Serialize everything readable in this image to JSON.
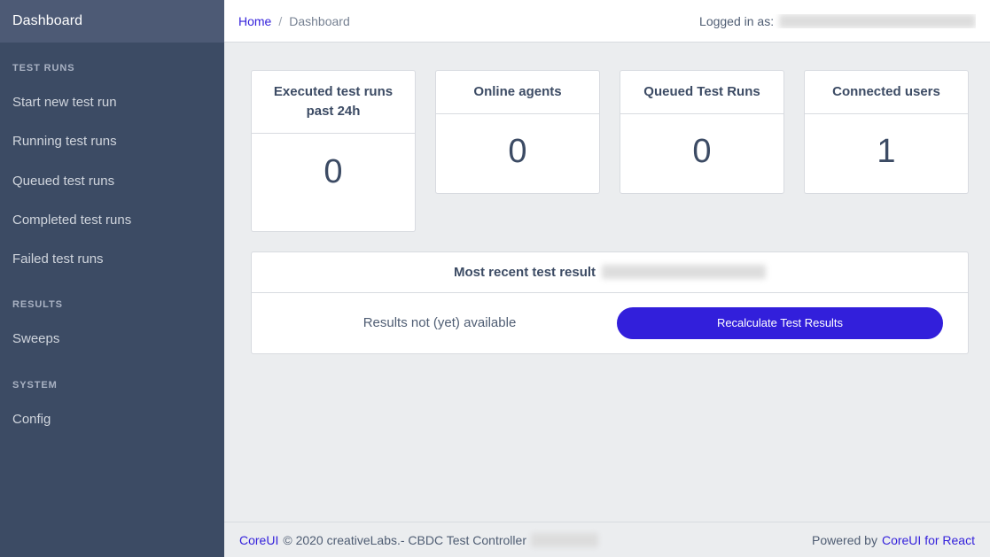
{
  "sidebar": {
    "brand": "Dashboard",
    "groups": [
      {
        "title": "TEST RUNS",
        "items": [
          {
            "label": "Start new test run"
          },
          {
            "label": "Running test runs"
          },
          {
            "label": "Queued test runs"
          },
          {
            "label": "Completed test runs"
          },
          {
            "label": "Failed test runs"
          }
        ]
      },
      {
        "title": "RESULTS",
        "items": [
          {
            "label": "Sweeps"
          }
        ]
      },
      {
        "title": "SYSTEM",
        "items": [
          {
            "label": "Config"
          }
        ]
      }
    ]
  },
  "header": {
    "breadcrumb": {
      "home": "Home",
      "separator": "/",
      "current": "Dashboard"
    },
    "logged_in_label": "Logged in as:",
    "logged_in_user": "Redacted User Name Organization"
  },
  "stats": [
    {
      "title": "Executed test runs past 24h",
      "value": "0",
      "tall": true
    },
    {
      "title": "Online agents",
      "value": "0",
      "tall": false
    },
    {
      "title": "Queued Test Runs",
      "value": "0",
      "tall": false
    },
    {
      "title": "Connected users",
      "value": "1",
      "tall": false
    }
  ],
  "result_panel": {
    "title": "Most recent test result",
    "timestamp_redacted": "January 19, 2021 1:01 PM",
    "status": "Results not (yet) available",
    "button_label": "Recalculate Test Results"
  },
  "footer": {
    "brand_link": "CoreUI",
    "copyright": "© 2020 creativeLabs.- CBDC Test Controller",
    "version_redacted": "v0.0.1 build",
    "powered_by": "Powered by",
    "powered_link": "CoreUI for React"
  },
  "colors": {
    "sidebar_bg": "#3c4b64",
    "sidebar_brand_bg": "#4d5a75",
    "primary": "#321fdb",
    "content_bg": "#ebedef",
    "border": "#d8dbe0"
  }
}
